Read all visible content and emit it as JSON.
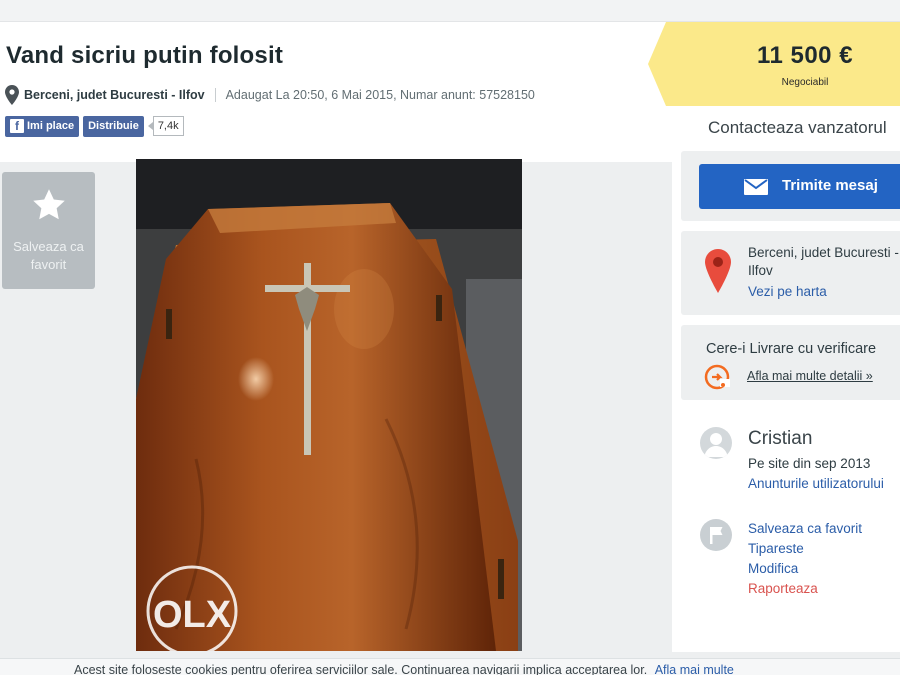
{
  "listing": {
    "title": "Vand sicriu putin folosit",
    "location": "Berceni, judet Bucuresti - Ilfov",
    "meta": "Adaugat La 20:50, 6 Mai 2015, Numar anunt: 57528150"
  },
  "social": {
    "like_label": "Imi place",
    "share_label": "Distribuie",
    "share_count": "7,4k"
  },
  "favorite_box": {
    "label_line1": "Salveaza ca",
    "label_line2": "favorit"
  },
  "photo": {
    "watermark": "OLX"
  },
  "price": {
    "amount": "11 500 €",
    "note": "Negociabil"
  },
  "contact": {
    "heading": "Contacteaza vanzatorul",
    "message_button": "Trimite mesaj"
  },
  "address": {
    "line1": "Berceni, judet Bucuresti -",
    "line2": "Ilfov",
    "map_link": "Vezi pe harta"
  },
  "delivery": {
    "title": "Cere-i Livrare cu verificare",
    "link": "Afla mai multe detalii »"
  },
  "seller": {
    "name": "Cristian",
    "since": "Pe site din sep 2013",
    "ads_link": "Anunturile utilizatorului"
  },
  "actions": {
    "save_favorite": "Salveaza ca favorit",
    "print": "Tipareste",
    "edit": "Modifica",
    "report": "Raporteaza"
  },
  "cookie": {
    "text": "Acest site foloseste cookies pentru oferirea serviciilor sale. Continuarea navigarii implica acceptarea lor.",
    "link": "Afla mai multe"
  },
  "colors": {
    "price_tag": "#fbe98a",
    "primary_button": "#2364c3",
    "link": "#2b5da8",
    "report_link": "#d9534f",
    "map_pin": "#e84c3d",
    "delivery_icon": "#f36b20",
    "facebook": "#4a66a0"
  },
  "icons": [
    "location-pin-icon",
    "facebook-icon",
    "star-icon",
    "envelope-icon",
    "map-pin-icon",
    "delivery-icon",
    "user-avatar-icon",
    "flag-icon"
  ]
}
